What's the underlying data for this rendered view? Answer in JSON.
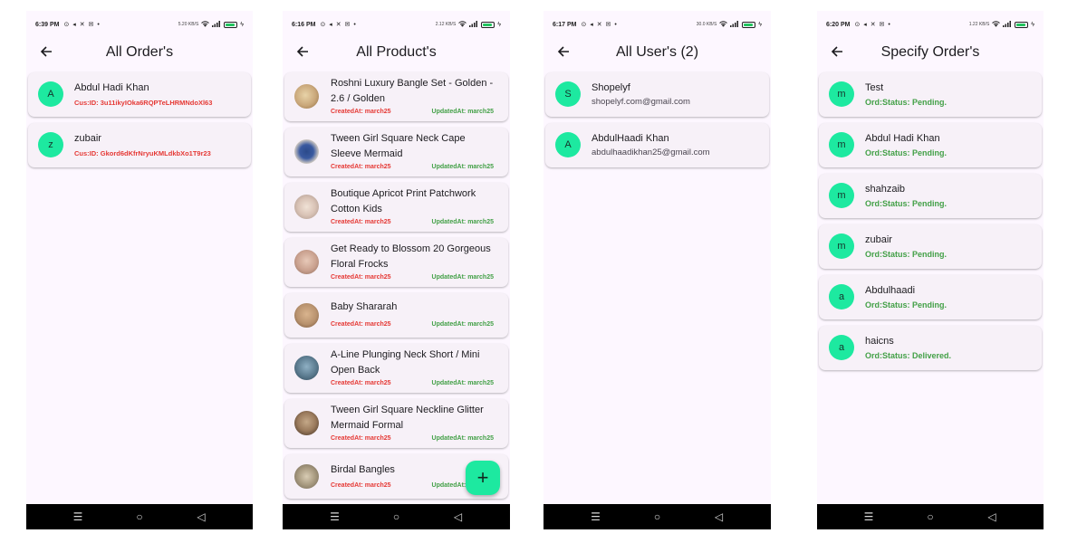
{
  "screens": [
    {
      "status": {
        "time": "6:39 PM",
        "icons": "⊙ ◂ ✕ ✉ •",
        "signal": "5.20 KB/S"
      },
      "title": "All Order's",
      "items": [
        {
          "initial": "A",
          "name": "Abdul Hadi Khan",
          "sub": "Cus:ID: 3u11ikyIOka6RQPTeLHRMNdoXl63"
        },
        {
          "initial": "z",
          "name": "zubair",
          "sub": "Cus:ID: Gkord6dKfrNryuKMLdkbXo1T9r23"
        }
      ]
    },
    {
      "status": {
        "time": "6:16 PM",
        "icons": "⊙ ◂ ✕ ✉ •",
        "signal": "2.12 KB/S"
      },
      "title": "All Product's",
      "created_label": "CreatedAt: march25",
      "updated_label": "UpdatedAt: march25",
      "fab": "+",
      "items": [
        {
          "name": "Roshni Luxury Bangle Set - Golden - 2.6 / Golden",
          "thumb_color": "#c9a77a"
        },
        {
          "name": "Tween Girl Square Neck Cape Sleeve Mermaid",
          "thumb_color": "#2b4a8a"
        },
        {
          "name": "Boutique Apricot Print Patchwork Cotton Kids",
          "thumb_color": "#d9c3b6"
        },
        {
          "name": "Get Ready to Blossom 20 Gorgeous Floral Frocks",
          "thumb_color": "#c9a08e"
        },
        {
          "name": "Baby Shararah",
          "thumb_color": "#b8926e"
        },
        {
          "name": "A-Line Plunging Neck Short / Mini Open Back",
          "thumb_color": "#5a7a8e"
        },
        {
          "name": "Tween Girl Square Neckline Glitter Mermaid Formal",
          "thumb_color": "#9a7a5c"
        },
        {
          "name": "Birdal Bangles",
          "thumb_color": "#a89a80"
        }
      ]
    },
    {
      "status": {
        "time": "6:17 PM",
        "icons": "⊙ ◂ ✕ ✉ •",
        "signal": "30.0 KB/S"
      },
      "title": "All User's (2)",
      "items": [
        {
          "initial": "S",
          "name": "Shopelyf",
          "sub": "shopelyf.com@gmail.com"
        },
        {
          "initial": "A",
          "name": "AbdulHaadi Khan",
          "sub": "abdulhaadikhan25@gmail.com"
        }
      ]
    },
    {
      "status": {
        "time": "6:20 PM",
        "icons": "⊙ ◂ ✕ ✉ •",
        "signal": "1.22 KB/S"
      },
      "title": "Specify Order's",
      "items": [
        {
          "initial": "m",
          "name": "Test",
          "sub": "Ord:Status: Pending."
        },
        {
          "initial": "m",
          "name": "Abdul Hadi Khan",
          "sub": "Ord:Status: Pending."
        },
        {
          "initial": "m",
          "name": "shahzaib",
          "sub": "Ord:Status: Pending."
        },
        {
          "initial": "m",
          "name": "zubair",
          "sub": "Ord:Status: Pending."
        },
        {
          "initial": "a",
          "name": "Abdulhaadi",
          "sub": "Ord:Status: Pending."
        },
        {
          "initial": "a",
          "name": "haicns",
          "sub": "Ord:Status: Delivered."
        }
      ]
    }
  ],
  "nav": {
    "menu": "☰",
    "home": "○",
    "back": "◁"
  },
  "colors": {
    "avatar": "#1de9a0",
    "background": "#fdf7ff",
    "card": "#f7f1f8",
    "red": "#e53935",
    "green": "#43a047"
  }
}
